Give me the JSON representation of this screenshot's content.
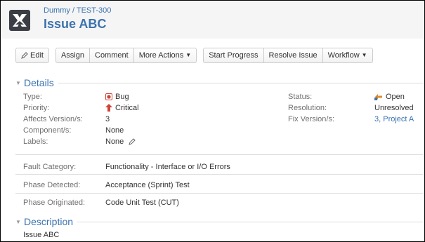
{
  "header": {
    "breadcrumb_project": "Dummy",
    "breadcrumb_sep": " / ",
    "breadcrumb_key": "TEST-300",
    "title": "Issue ABC"
  },
  "toolbar": {
    "edit": "Edit",
    "assign": "Assign",
    "comment": "Comment",
    "more_actions": "More Actions",
    "start_progress": "Start Progress",
    "resolve_issue": "Resolve Issue",
    "workflow": "Workflow"
  },
  "details": {
    "heading": "Details",
    "type_label": "Type:",
    "type_value": "Bug",
    "priority_label": "Priority:",
    "priority_value": "Critical",
    "affects_label": "Affects Version/s:",
    "affects_value": "3",
    "components_label": "Component/s:",
    "components_value": "None",
    "labels_label": "Labels:",
    "labels_value": "None",
    "status_label": "Status:",
    "status_value": "Open",
    "resolution_label": "Resolution:",
    "resolution_value": "Unresolved",
    "fix_label": "Fix Version/s:",
    "fix_value": "3, Project A"
  },
  "custom_fields": {
    "fault_label": "Fault Category:",
    "fault_value": "Functionality - Interface or I/O Errors",
    "phase_detected_label": "Phase Detected:",
    "phase_detected_value": "Acceptance (Sprint) Test",
    "phase_originated_label": "Phase Originated:",
    "phase_originated_value": "Code Unit Test (CUT)"
  },
  "description": {
    "heading": "Description",
    "text": "Issue ABC"
  },
  "colors": {
    "link": "#3b73af",
    "bug": "#d04437",
    "critical": "#d04437",
    "open": "#e08a2c"
  },
  "icons": [
    "project-avatar-icon",
    "pencil-icon",
    "chevron-down-icon",
    "bug-icon",
    "critical-priority-icon",
    "open-status-icon"
  ]
}
